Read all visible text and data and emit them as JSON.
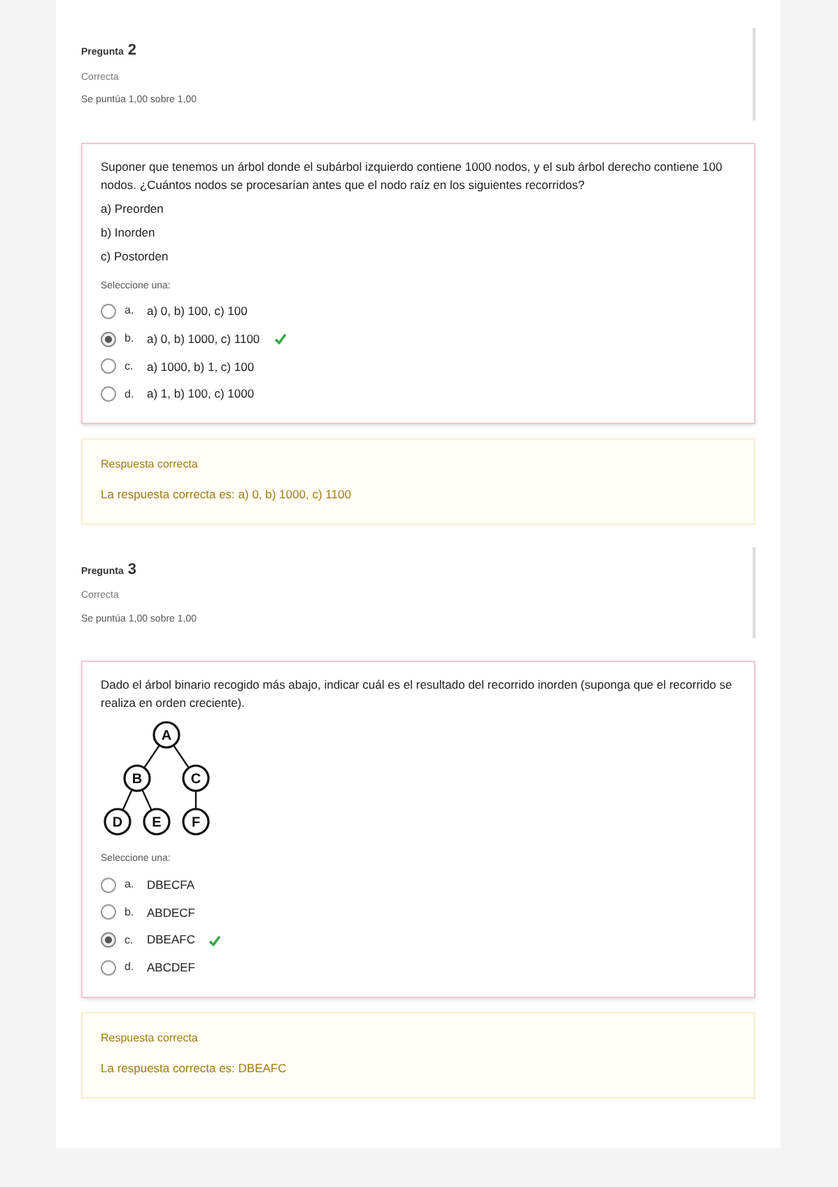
{
  "questions": [
    {
      "label": "Pregunta",
      "number": "2",
      "status": "Correcta",
      "grade": "Se puntúa 1,00 sobre 1,00",
      "text": [
        "Suponer que tenemos un árbol donde el subárbol izquierdo contiene 1000 nodos, y el sub árbol derecho contiene 100 nodos. ¿Cuántos nodos se procesarían antes que el nodo raíz en los siguientes recorridos?",
        "a) Preorden",
        "b) Inorden",
        "c) Postorden"
      ],
      "prompt": "Seleccione una:",
      "options": [
        {
          "letter": "a.",
          "text": "a) 0, b) 100, c) 100",
          "selected": false,
          "correct": false
        },
        {
          "letter": "b.",
          "text": "a) 0, b) 1000, c) 1100",
          "selected": true,
          "correct": true
        },
        {
          "letter": "c.",
          "text": "a) 1000, b) 1, c) 100",
          "selected": false,
          "correct": false
        },
        {
          "letter": "d.",
          "text": "a) 1, b) 100, c) 1000",
          "selected": false,
          "correct": false
        }
      ],
      "feedback": {
        "title": "Respuesta correcta",
        "text": "La respuesta correcta es: a) 0, b) 1000, c) 1100"
      }
    },
    {
      "label": "Pregunta",
      "number": "3",
      "status": "Correcta",
      "grade": "Se puntúa 1,00 sobre 1,00",
      "text": [
        "Dado el árbol binario recogido más abajo, indicar cuál es el resultado del recorrido inorden (suponga que el recorrido se realiza en orden creciente)."
      ],
      "tree": {
        "label": "A",
        "children": [
          {
            "label": "B",
            "children": [
              {
                "label": "D"
              },
              {
                "label": "E"
              }
            ]
          },
          {
            "label": "C",
            "children": [
              {
                "label": "F"
              }
            ]
          }
        ]
      },
      "prompt": "Seleccione una:",
      "options": [
        {
          "letter": "a.",
          "text": "DBECFA",
          "selected": false,
          "correct": false
        },
        {
          "letter": "b.",
          "text": "ABDECF",
          "selected": false,
          "correct": false
        },
        {
          "letter": "c.",
          "text": "DBEAFC",
          "selected": true,
          "correct": true
        },
        {
          "letter": "d.",
          "text": "ABCDEF",
          "selected": false,
          "correct": false
        }
      ],
      "feedback": {
        "title": "Respuesta correcta",
        "text": "La respuesta correcta es: DBEAFC"
      }
    }
  ]
}
